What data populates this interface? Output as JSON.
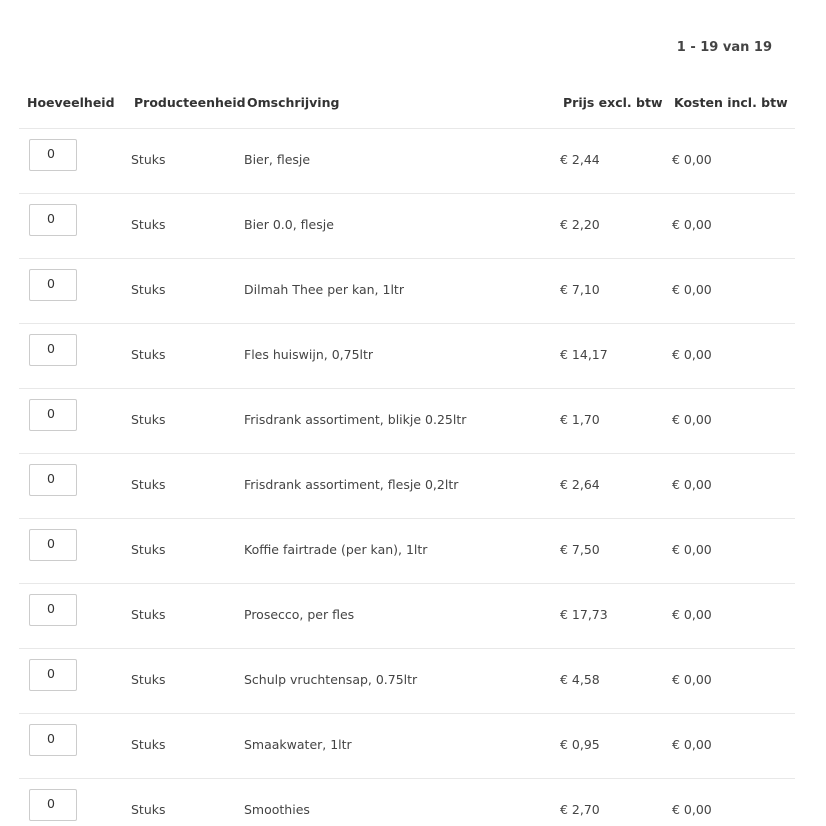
{
  "pagination": {
    "label": "1 - 19 van 19"
  },
  "table": {
    "headers": {
      "quantity": "Hoeveelheid",
      "unit": "Producteenheid",
      "description": "Omschrijving",
      "price": "Prijs excl. btw",
      "cost": "Kosten incl. btw"
    },
    "rows": [
      {
        "quantity": "0",
        "unit": "Stuks",
        "description": "Bier, flesje",
        "price": "€ 2,44",
        "cost": "€ 0,00"
      },
      {
        "quantity": "0",
        "unit": "Stuks",
        "description": "Bier 0.0, flesje",
        "price": "€ 2,20",
        "cost": "€ 0,00"
      },
      {
        "quantity": "0",
        "unit": "Stuks",
        "description": "Dilmah Thee per kan, 1ltr",
        "price": "€ 7,10",
        "cost": "€ 0,00"
      },
      {
        "quantity": "0",
        "unit": "Stuks",
        "description": "Fles huiswijn, 0,75ltr",
        "price": "€ 14,17",
        "cost": "€ 0,00"
      },
      {
        "quantity": "0",
        "unit": "Stuks",
        "description": "Frisdrank assortiment, blikje 0.25ltr",
        "price": "€ 1,70",
        "cost": "€ 0,00"
      },
      {
        "quantity": "0",
        "unit": "Stuks",
        "description": "Frisdrank assortiment, flesje 0,2ltr",
        "price": "€ 2,64",
        "cost": "€ 0,00"
      },
      {
        "quantity": "0",
        "unit": "Stuks",
        "description": "Koffie fairtrade (per kan), 1ltr",
        "price": "€ 7,50",
        "cost": "€ 0,00"
      },
      {
        "quantity": "0",
        "unit": "Stuks",
        "description": "Prosecco, per fles",
        "price": "€ 17,73",
        "cost": "€ 0,00"
      },
      {
        "quantity": "0",
        "unit": "Stuks",
        "description": "Schulp vruchtensap, 0.75ltr",
        "price": "€ 4,58",
        "cost": "€ 0,00"
      },
      {
        "quantity": "0",
        "unit": "Stuks",
        "description": "Smaakwater, 1ltr",
        "price": "€ 0,95",
        "cost": "€ 0,00"
      },
      {
        "quantity": "0",
        "unit": "Stuks",
        "description": "Smoothies",
        "price": "€ 2,70",
        "cost": "€ 0,00"
      }
    ]
  }
}
